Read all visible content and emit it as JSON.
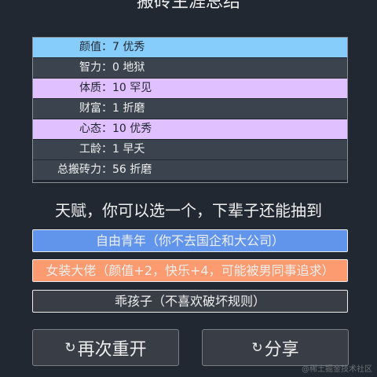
{
  "header": {
    "title": "搬砖生涯总结"
  },
  "stats": [
    {
      "label": "颜值",
      "value": "7 优秀",
      "tone": "blue"
    },
    {
      "label": "智力",
      "value": "0 地狱",
      "tone": "gray"
    },
    {
      "label": "体质",
      "value": "10 罕见",
      "tone": "purple"
    },
    {
      "label": "财富",
      "value": "1 折磨",
      "tone": "gray"
    },
    {
      "label": "心态",
      "value": "10 优秀",
      "tone": "purple"
    },
    {
      "label": "工龄",
      "value": "1 早夭",
      "tone": "gray"
    },
    {
      "label": "总搬砖力",
      "value": "56 折磨",
      "tone": "gray"
    }
  ],
  "talent_prompt": "天赋，你可以选一个，下辈子还能抽到",
  "talents": [
    {
      "text": "自由青年（你不去国企和大公司）",
      "color": "#6195eb"
    },
    {
      "text": "女装大佬（颜值+2，快乐+4，可能被男同事追求）",
      "color": "#fc9b70"
    },
    {
      "text": "乖孩子（不喜欢破坏规则）",
      "color": "#393e46"
    }
  ],
  "buttons": {
    "restart_label": "再次重开",
    "share_label": "分享",
    "restart_icon": "refresh-icon",
    "share_icon": "refresh-icon"
  },
  "watermark": "@稀土掘金技术社区",
  "colors": {
    "background": "#222831",
    "stat_blue": "#87cdfc",
    "stat_purple": "#e1c0ff",
    "stat_gray": "#3b444e"
  }
}
